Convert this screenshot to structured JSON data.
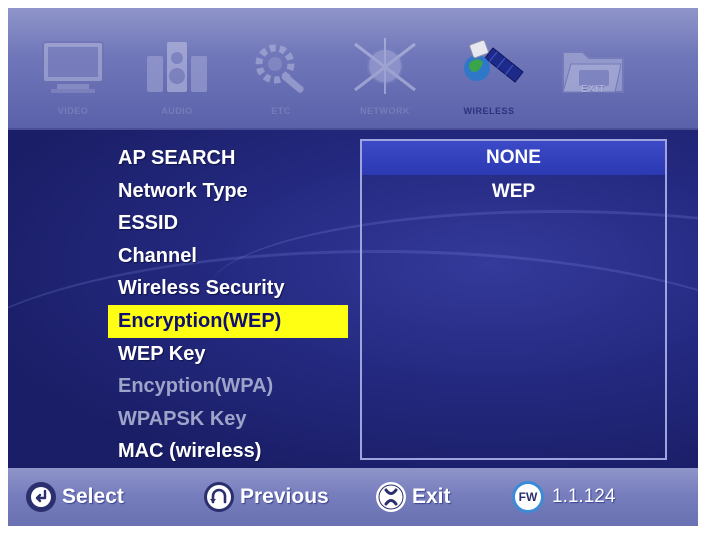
{
  "top_menu": [
    {
      "label": "VIDEO",
      "icon": "tv-icon",
      "state": "dim"
    },
    {
      "label": "AUDIO",
      "icon": "speaker-icon",
      "state": "dim"
    },
    {
      "label": "ETC",
      "icon": "tools-icon",
      "state": "dim"
    },
    {
      "label": "NETWORK",
      "icon": "network-globe-icon",
      "state": "dim"
    },
    {
      "label": "WIRELESS",
      "icon": "satellite-icon",
      "state": "active"
    },
    {
      "label": "EXIT",
      "icon": "exit-folder-icon",
      "state": "dim"
    }
  ],
  "settings_list": [
    {
      "label": "AP SEARCH",
      "state": "normal"
    },
    {
      "label": "Network Type",
      "state": "normal"
    },
    {
      "label": "ESSID",
      "state": "normal"
    },
    {
      "label": "Channel",
      "state": "normal"
    },
    {
      "label": "Wireless Security",
      "state": "normal"
    },
    {
      "label": "Encryption(WEP)",
      "state": "selected"
    },
    {
      "label": "WEP Key",
      "state": "normal"
    },
    {
      "label": "Encyption(WPA)",
      "state": "disabled"
    },
    {
      "label": "WPAPSK Key",
      "state": "disabled"
    },
    {
      "label": "MAC (wireless)",
      "state": "normal"
    }
  ],
  "encryption_options": [
    {
      "label": "NONE",
      "state": "highlighted"
    },
    {
      "label": "WEP",
      "state": "normal"
    }
  ],
  "footer": {
    "select_label": "Select",
    "previous_label": "Previous",
    "exit_label": "Exit",
    "fw_badge": "FW",
    "fw_version": "1.1.124"
  },
  "colors": {
    "selection_yellow": "#ffff14",
    "highlight_blue": "#2f3db8",
    "background_navy": "#1f2470"
  }
}
